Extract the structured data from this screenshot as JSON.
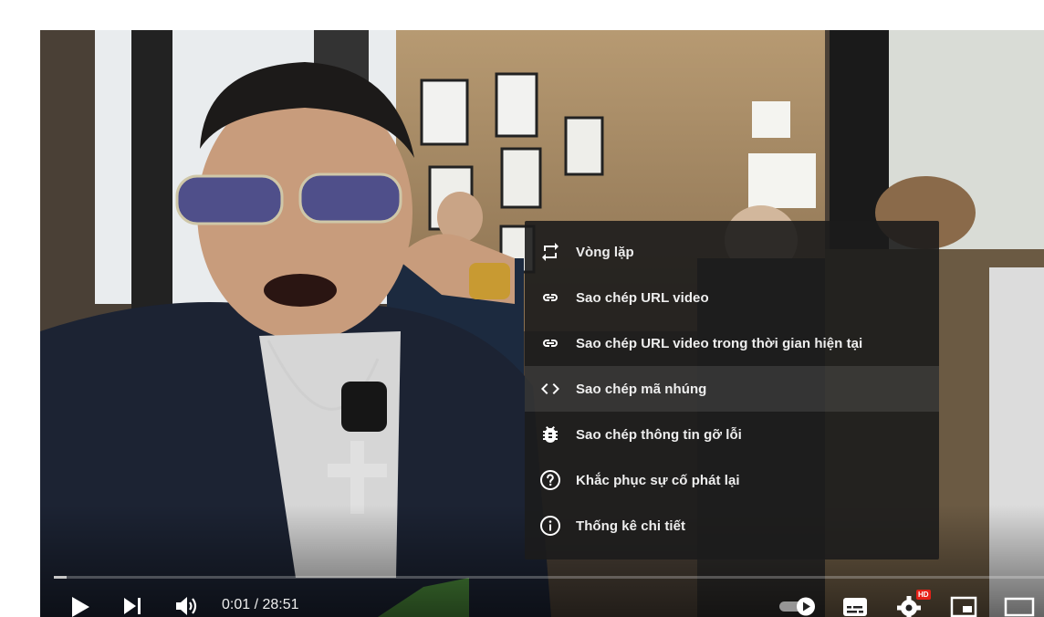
{
  "player": {
    "current_time": "0:01",
    "separator": " / ",
    "duration": "28:51",
    "progress_fraction": 0.0006,
    "hd_badge": "HD"
  },
  "context_menu": {
    "items": [
      {
        "label": "Vòng lặp",
        "icon": "loop-icon"
      },
      {
        "label": "Sao chép URL video",
        "icon": "link-icon"
      },
      {
        "label": "Sao chép URL video trong thời gian hiện tại",
        "icon": "link-icon"
      },
      {
        "label": "Sao chép mã nhúng",
        "icon": "embed-code-icon"
      },
      {
        "label": "Sao chép thông tin gỡ lỗi",
        "icon": "bug-icon"
      },
      {
        "label": "Khắc phục sự cố phát lại",
        "icon": "help-circle-icon"
      },
      {
        "label": "Thống kê chi tiết",
        "icon": "info-circle-icon"
      }
    ],
    "highlighted_index": 3
  },
  "colors": {
    "menu_bg": "#1c1c1c",
    "text": "#eeeeee",
    "hd_badge": "#e62117"
  }
}
